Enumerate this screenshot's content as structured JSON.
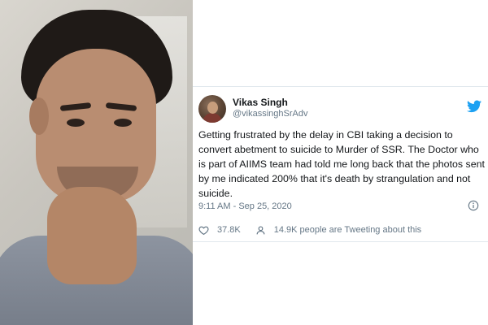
{
  "photo": {
    "subject": "portrait-photo"
  },
  "tweet": {
    "author": {
      "display_name": "Vikas Singh",
      "handle": "@vikassinghSrAdv",
      "avatar_icon": "avatar"
    },
    "platform_icon": "twitter-bird-icon",
    "brand_color": "#1da1f2",
    "text": "Getting frustrated by the delay in CBI taking a decision to convert abetment to suicide to Murder of SSR. The Doctor who is part of AIIMS team had told me long back that the photos sent by me indicated 200% that it's death by strangulation and not suicide.",
    "timestamp": "9:11 AM - Sep 25, 2020",
    "likes": "37.8K",
    "tweeting_about": "14.9K people are Tweeting about this"
  }
}
